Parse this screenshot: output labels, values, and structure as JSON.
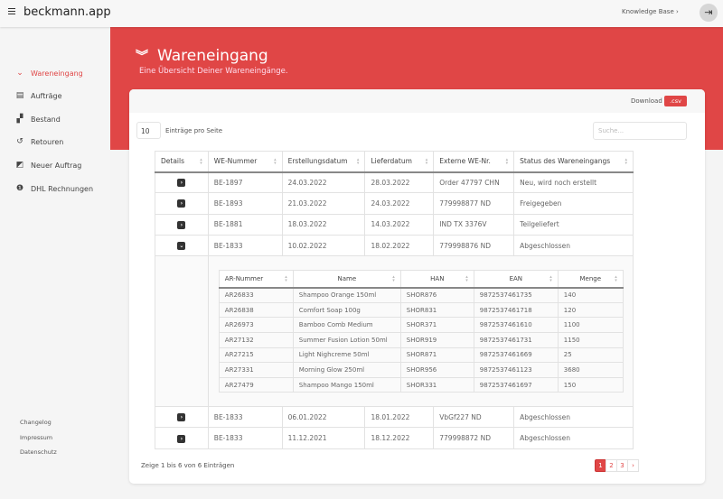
{
  "header": {
    "brand": "beckmann.app",
    "knowledge_base": "Knowledge Base ›"
  },
  "sidebar": {
    "items": [
      {
        "label": "Wareneingang",
        "icon": "double-chevron-down-icon",
        "glyph": "⌄",
        "active": true
      },
      {
        "label": "Aufträge",
        "icon": "list-icon",
        "glyph": "▤"
      },
      {
        "label": "Bestand",
        "icon": "boxes-icon",
        "glyph": "▞"
      },
      {
        "label": "Retouren",
        "icon": "undo-icon",
        "glyph": "↺"
      },
      {
        "label": "Neuer Auftrag",
        "icon": "edit-icon",
        "glyph": "◩"
      },
      {
        "label": "DHL Rechnungen",
        "icon": "info-icon",
        "glyph": "❶"
      }
    ],
    "footer": [
      "Changelog",
      "Impressum",
      "Datenschutz"
    ]
  },
  "page": {
    "title": "Wareneingang",
    "subtitle": "Eine Übersicht Deiner Wareneingänge."
  },
  "toolbar": {
    "download": "Download",
    "csv": ".csv",
    "per_page": "10",
    "per_page_label": "Einträge pro Seite",
    "search_placeholder": "Suche..."
  },
  "table": {
    "columns": [
      "Details",
      "WE-Nummer",
      "Erstellungsdatum",
      "Lieferdatum",
      "Externe WE-Nr.",
      "Status des Wareneingangs"
    ],
    "rows": [
      [
        "BE-1897",
        "24.03.2022",
        "28.03.2022",
        "Order 47797 CHN",
        "Neu, wird noch erstellt"
      ],
      [
        "BE-1893",
        "21.03.2022",
        "24.03.2022",
        "779998877 ND",
        "Freigegeben"
      ],
      [
        "BE-1881",
        "18.03.2022",
        "14.03.2022",
        "IND TX 3376V",
        "Teilgeliefert"
      ],
      [
        "BE-1833",
        "10.02.2022",
        "18.02.2022",
        "779998876 ND",
        "Abgeschlossen"
      ],
      [
        "BE-1833",
        "06.01.2022",
        "18.01.2022",
        "VbGf227 ND",
        "Abgeschlossen"
      ],
      [
        "BE-1833",
        "11.12.2021",
        "18.12.2022",
        "779998872 ND",
        "Abgeschlossen"
      ]
    ],
    "expanded_row": 3
  },
  "details": {
    "columns": [
      "AR-Nummer",
      "Name",
      "HAN",
      "EAN",
      "Menge"
    ],
    "rows": [
      [
        "AR26833",
        "Shampoo Orange 150ml",
        "SHOR876",
        "9872537461735",
        "140"
      ],
      [
        "AR26838",
        "Comfort Soap 100g",
        "SHOR831",
        "9872537461718",
        "120"
      ],
      [
        "AR26973",
        "Bamboo Comb Medium",
        "SHOR371",
        "9872537461610",
        "1100"
      ],
      [
        "AR27132",
        "Summer Fusion Lotion 50ml",
        "SHOR919",
        "9872537461731",
        "1150"
      ],
      [
        "AR27215",
        "Light Nighcreme 50ml",
        "SHOR871",
        "9872537461669",
        "25"
      ],
      [
        "AR27331",
        "Morning Glow 250ml",
        "SHOR956",
        "9872537461123",
        "3680"
      ],
      [
        "AR27479",
        "Shampoo Mango 150ml",
        "SHOR331",
        "9872537461697",
        "150"
      ]
    ]
  },
  "footer": {
    "info": "Zeige 1 bis 6 von 6 Einträgen",
    "pages": [
      "1",
      "2",
      "3",
      "›"
    ],
    "current_page": "1"
  },
  "colors": {
    "accent": "#e04646"
  }
}
